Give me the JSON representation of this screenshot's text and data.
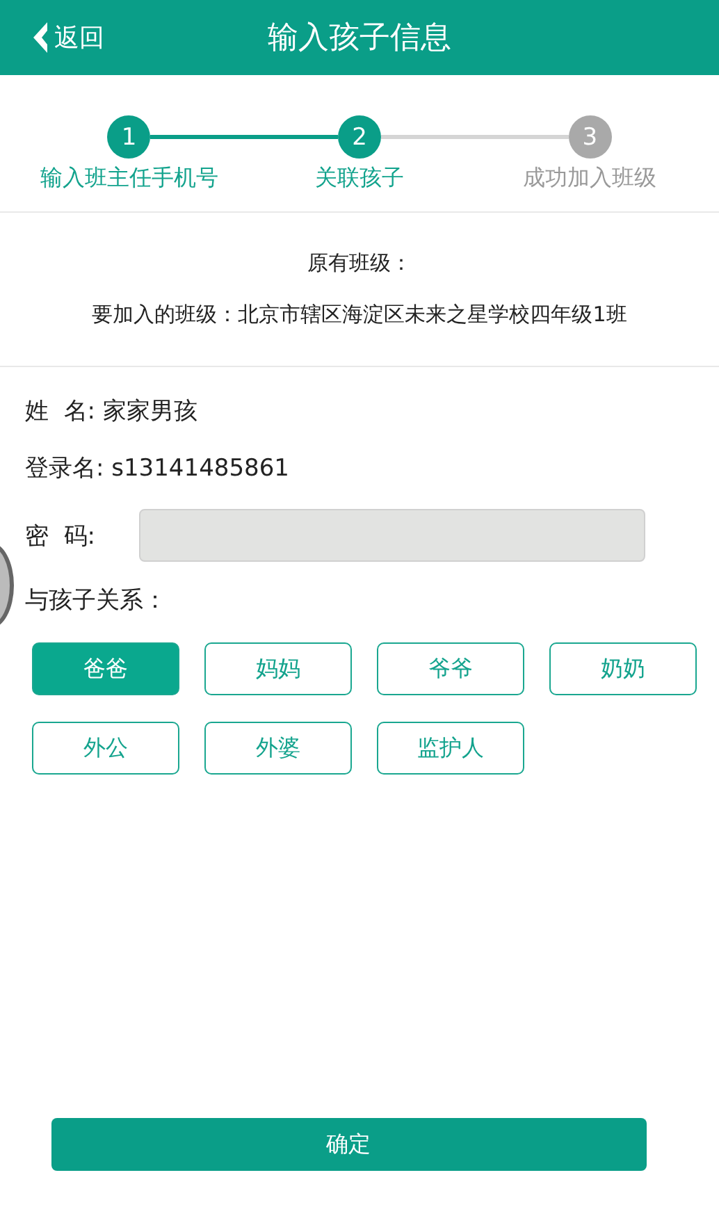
{
  "header": {
    "back": "返回",
    "title": "输入孩子信息"
  },
  "steps": [
    {
      "number": "1",
      "label": "输入班主任手机号",
      "active": true
    },
    {
      "number": "2",
      "label": "关联孩子",
      "active": true
    },
    {
      "number": "3",
      "label": "成功加入班级",
      "active": false
    }
  ],
  "class_info": {
    "original": "原有班级：",
    "target": "要加入的班级：北京市辖区海淀区未来之星学校四年级1班"
  },
  "child": {
    "name": "姓  名: 家家男孩",
    "login": "登录名: s13141485861",
    "password_label": "密  码:"
  },
  "relation": {
    "label": "与孩子关系：",
    "options": [
      {
        "label": "爸爸",
        "selected": true
      },
      {
        "label": "妈妈",
        "selected": false
      },
      {
        "label": "爷爷",
        "selected": false
      },
      {
        "label": "奶奶",
        "selected": false
      },
      {
        "label": "外公",
        "selected": false
      },
      {
        "label": "外婆",
        "selected": false
      },
      {
        "label": "监护人",
        "selected": false
      }
    ]
  },
  "confirm": "确定"
}
